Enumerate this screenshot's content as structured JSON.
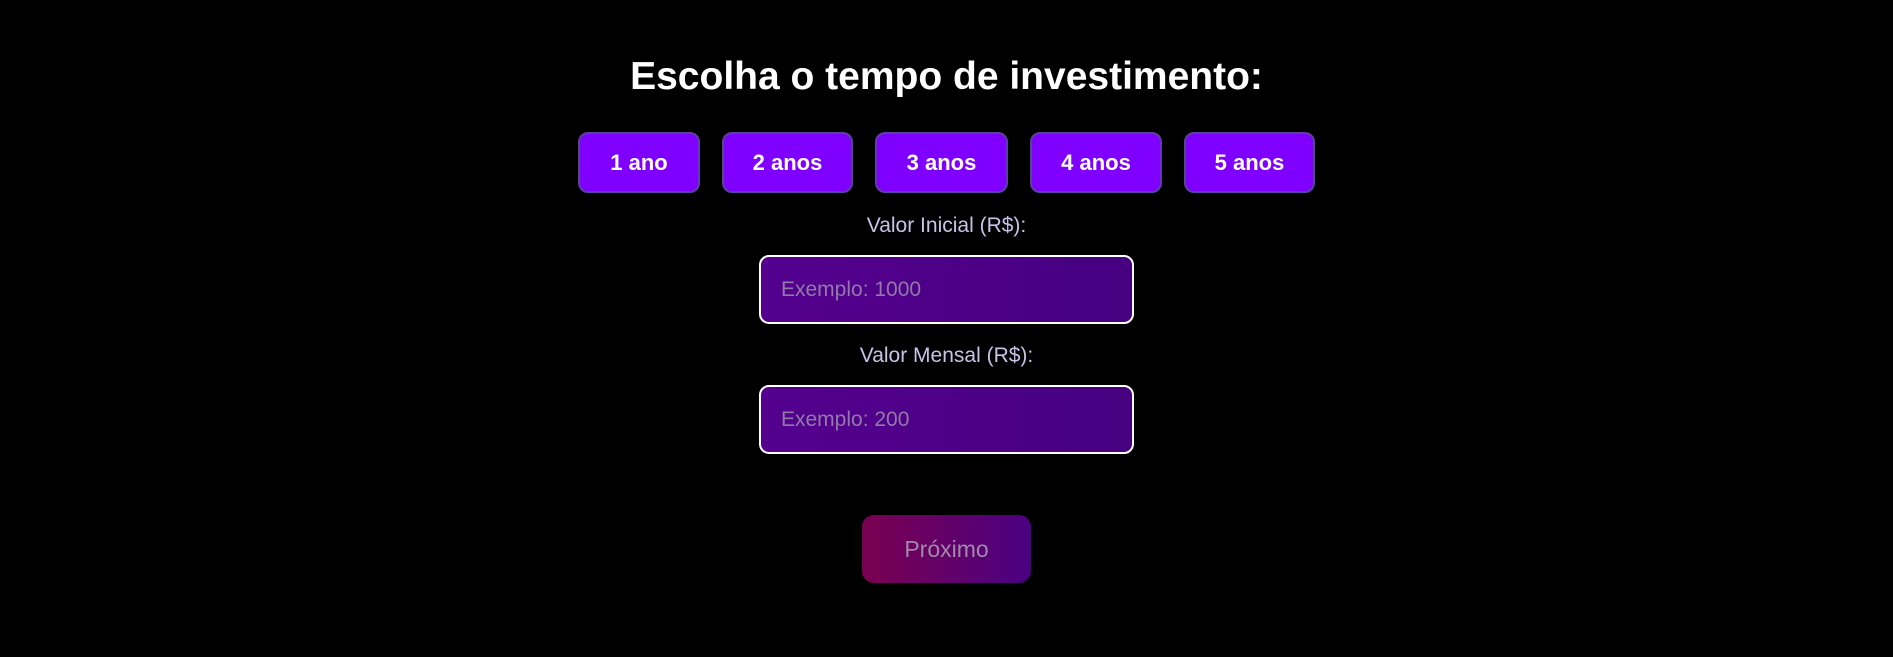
{
  "heading": "Escolha o tempo de investimento:",
  "durations": [
    {
      "label": "1 ano"
    },
    {
      "label": "2 anos"
    },
    {
      "label": "3 anos"
    },
    {
      "label": "4 anos"
    },
    {
      "label": "5 anos"
    }
  ],
  "initial_value": {
    "label": "Valor Inicial (R$):",
    "placeholder": "Exemplo: 1000",
    "value": ""
  },
  "monthly_value": {
    "label": "Valor Mensal (R$):",
    "placeholder": "Exemplo: 200",
    "value": ""
  },
  "next_button": {
    "label": "Próximo"
  },
  "colors": {
    "background": "#000000",
    "duration_button": "#7f00ff",
    "input_background": "#4b0082",
    "next_button_start": "#7a0050",
    "next_button_end": "#4a0082"
  }
}
